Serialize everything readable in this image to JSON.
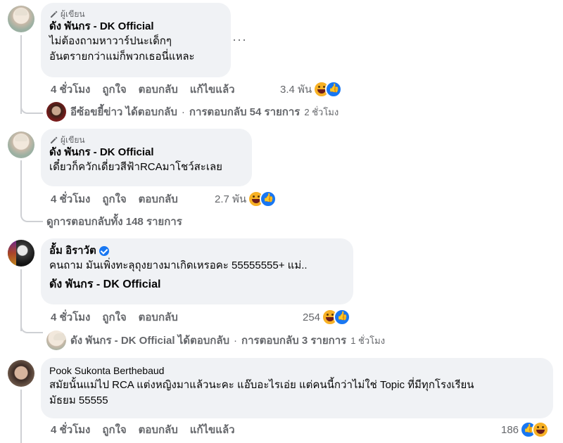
{
  "author_badge": "ผู้เขียน",
  "comments": [
    {
      "author": "ดัง พันกร - DK Official",
      "text": [
        "ไม่ต้องถามหาวาร์ปนะเด็กๆ",
        "อันตรายกว่าแม่ก็พวกเธอนี่แหละ"
      ],
      "time": "4 ชั่วโมง",
      "like": "ถูกใจ",
      "reply": "ตอบกลับ",
      "edited": "แก้ไขแล้ว",
      "reactions": "3.4 พัน",
      "reply_summary": {
        "names": "อีซ้อขยี้ข่าว ได้ตอบกลับ",
        "sep": "·",
        "count": "การตอบกลับ 54 รายการ",
        "time": "2 ชั่วโมง"
      }
    },
    {
      "author": "ดัง พันกร - DK Official",
      "text": [
        "เดี๋ยวก็ควักเดี่ยวสีฟ้าRCAมาโชว์สะเลย"
      ],
      "time": "4 ชั่วโมง",
      "like": "ถูกใจ",
      "reply": "ตอบกลับ",
      "reactions": "2.7 พัน",
      "view_replies": "ดูการตอบกลับทั้ง 148 รายการ"
    },
    {
      "author": "อั้ม อิราวัต",
      "text": [
        "คนถาม มันเพิ่งทะลุถุงยางมาเกิดเหรอคะ 55555555+ แม่.."
      ],
      "mention": "ดัง พันกร - DK Official",
      "time": "4 ชั่วโมง",
      "like": "ถูกใจ",
      "reply": "ตอบกลับ",
      "reactions": "254",
      "reply_summary": {
        "names": "ดัง พันกร - DK Official ได้ตอบกลับ",
        "sep": "·",
        "count": "การตอบกลับ 3 รายการ",
        "time": "1 ชั่วโมง"
      }
    },
    {
      "author": "Pook Sukonta Berthebaud",
      "text": [
        "สมัยนั้นแม่ไป RCA แต่งหญิงมาแล้วนะคะ แอ๊บอะไรเอ่ย แต่คนนี้กว่าไม่ใช่ Topic ที่มีทุกโรงเรียน",
        "มัธยม 55555"
      ],
      "time": "4 ชั่วโมง",
      "like": "ถูกใจ",
      "reply": "ตอบกลับ",
      "edited": "แก้ไขแล้ว",
      "reactions": "186"
    }
  ],
  "more_label": "···",
  "colors": {
    "bubble": "#f0f2f5",
    "meta": "#65676b",
    "text": "#050505",
    "like_blue": "#1877f2",
    "haha_yellow": "#f7b125"
  }
}
